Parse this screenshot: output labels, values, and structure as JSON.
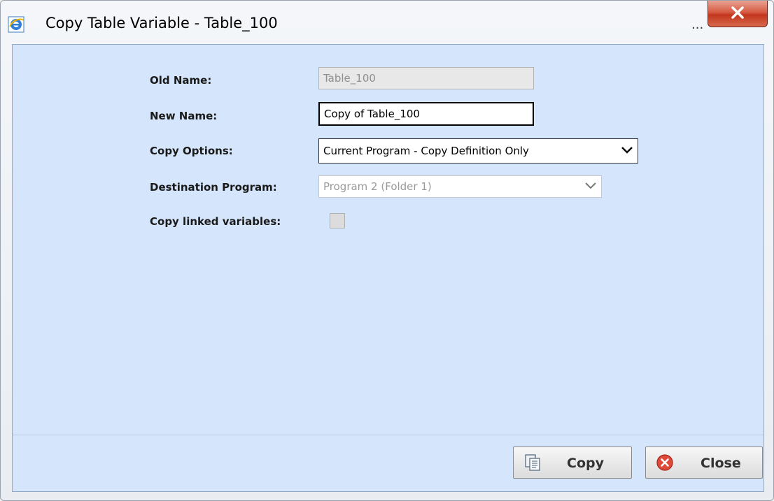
{
  "window": {
    "title": "Copy Table Variable - Table_100",
    "ellipsis": "...",
    "close_glyph": "X",
    "title_icon": "ie-icon"
  },
  "form": {
    "old_name_label": "Old Name:",
    "old_name_value": "Table_100",
    "new_name_label": "New Name:",
    "new_name_value": "Copy of Table_100",
    "copy_options_label": "Copy Options:",
    "copy_options_value": "Current Program - Copy Definition Only",
    "destination_label": "Destination Program:",
    "destination_value": "Program 2 (Folder 1)",
    "copy_linked_label": "Copy linked variables:",
    "copy_linked_checked": false
  },
  "buttons": {
    "copy_label": "Copy",
    "copy_icon": "copy-icon",
    "close_label": "Close",
    "close_icon": "close-circle-icon"
  },
  "colors": {
    "content_bg": "#d5e5fb",
    "close_red": "#c2361d"
  }
}
